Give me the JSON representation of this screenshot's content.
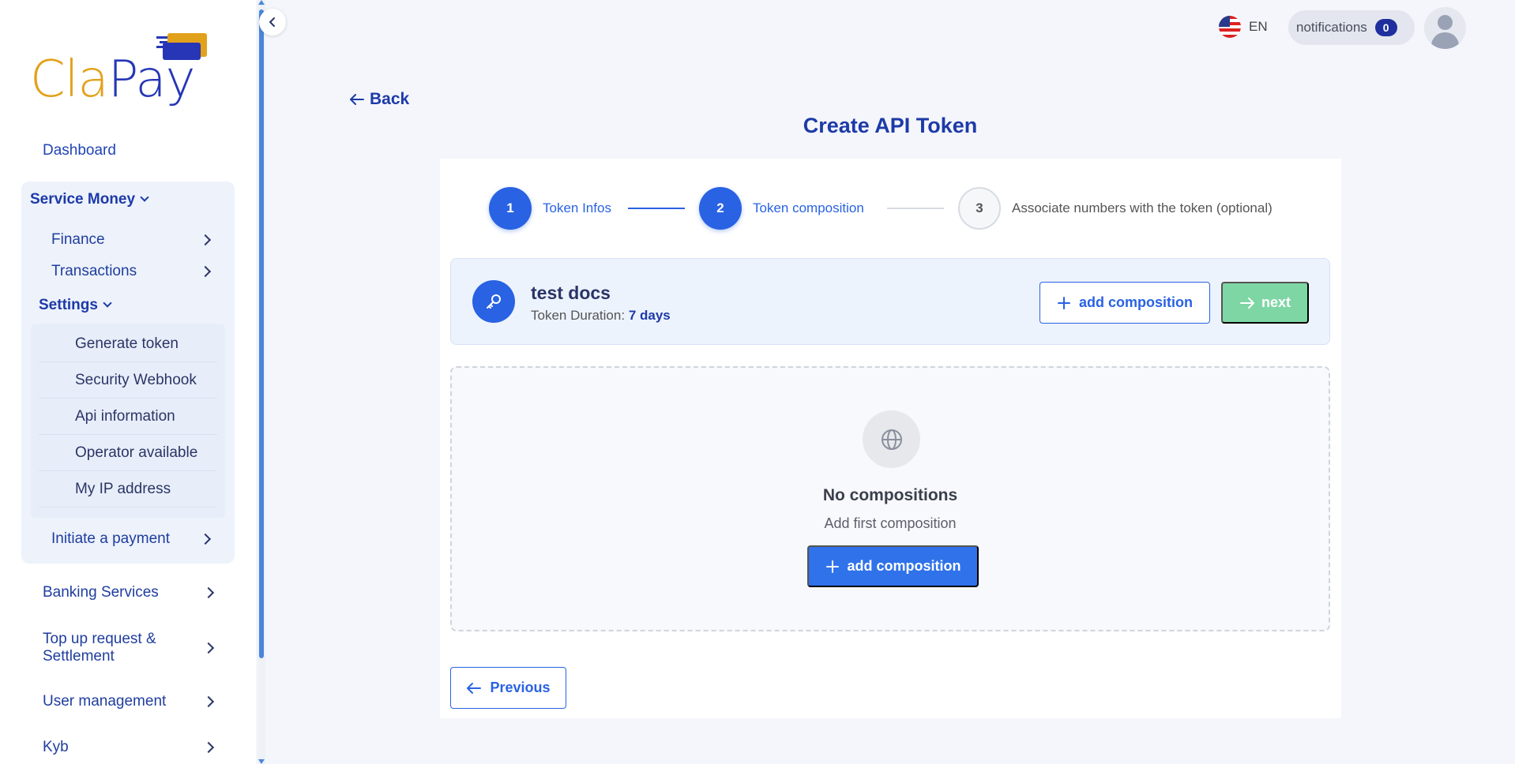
{
  "brand": {
    "logo_left": "Cla",
    "logo_right": "Pay"
  },
  "sidebar": {
    "dashboard": "Dashboard",
    "service_money": {
      "title": "Service Money",
      "items": [
        {
          "label": "Finance"
        },
        {
          "label": "Transactions"
        }
      ],
      "settings": {
        "title": "Settings",
        "items": [
          {
            "label": "Generate token"
          },
          {
            "label": "Security Webhook"
          },
          {
            "label": "Api information"
          },
          {
            "label": "Operator available"
          },
          {
            "label": "My IP address"
          }
        ]
      },
      "initiate_payment": "Initiate a payment"
    },
    "bottom_items": [
      {
        "label": "Banking Services"
      },
      {
        "label": "Top up request & Settlement"
      },
      {
        "label": "User management"
      },
      {
        "label": "Kyb"
      }
    ]
  },
  "topbar": {
    "language": "EN",
    "notifications_label": "notifications",
    "notifications_count": "0"
  },
  "page": {
    "back_label": "Back",
    "title": "Create API Token"
  },
  "stepper": {
    "steps": [
      {
        "number": "1",
        "label": "Token Infos",
        "state": "completed"
      },
      {
        "number": "2",
        "label": "Token composition",
        "state": "active"
      },
      {
        "number": "3",
        "label": "Associate numbers with the token (optional)",
        "state": "pending"
      }
    ]
  },
  "token": {
    "name": "test docs",
    "duration_label": "Token Duration:",
    "duration_value": "7 days",
    "add_composition_label": "add composition",
    "next_label": "next"
  },
  "empty_state": {
    "title": "No compositions",
    "subtitle": "Add first composition",
    "button_label": "add composition"
  },
  "footer": {
    "previous_label": "Previous"
  },
  "colors": {
    "primary": "#2962e3",
    "brand_blue": "#1d3aa8",
    "brand_orange": "#e2a11b",
    "next_button": "#7ed6a4"
  }
}
